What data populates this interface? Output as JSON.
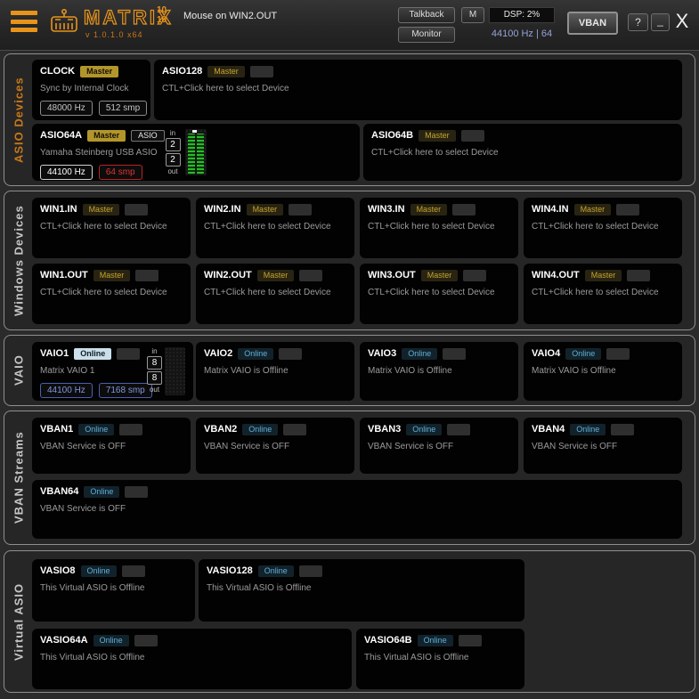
{
  "colors": {
    "accent_orange": "#e8941a",
    "master_gold": "#b3962a",
    "online_blue": "#5fb0d8",
    "alert_red": "#e23333",
    "vaio_blue": "#8096e0",
    "meter_green": "#27bd27"
  },
  "header": {
    "app_name": "MATRIX",
    "channels_top": "10",
    "channels_bottom": "10",
    "version": "v 1.0.1.0 x64",
    "status": "Mouse on WIN2.OUT",
    "talkback_label": "Talkback",
    "monitor_label": "Monitor",
    "mute_label": "M",
    "dsp_load": "DSP: 2%",
    "samplerate_info": "44100 Hz | 64",
    "vban_label": "VBAN",
    "help_label": "?",
    "minimize_label": "_",
    "close_label": "X"
  },
  "sections": {
    "asio": {
      "label": "ASIO Devices",
      "cells": {
        "clock": {
          "title": "CLOCK",
          "badge": "Master",
          "desc": "Sync by Internal Clock",
          "rate": "48000 Hz",
          "buffer": "512 smp"
        },
        "asio128": {
          "title": "ASIO128",
          "badge": "Master",
          "desc": "CTL+Click here to select Device"
        },
        "asio64a": {
          "title": "ASIO64A",
          "badge": "Master",
          "badge2": "ASIO",
          "desc": "Yamaha Steinberg USB ASIO",
          "rate": "44100 Hz",
          "buffer": "64 smp",
          "io": {
            "in_label": "in",
            "in_count": "2",
            "out_count": "2",
            "out_label": "out"
          }
        },
        "asio64b": {
          "title": "ASIO64B",
          "badge": "Master",
          "desc": "CTL+Click here to select Device"
        }
      }
    },
    "windows": {
      "label": "Windows Devices",
      "cells": {
        "win1in": {
          "title": "WIN1.IN",
          "badge": "Master",
          "desc": "CTL+Click here to select Device"
        },
        "win2in": {
          "title": "WIN2.IN",
          "badge": "Master",
          "desc": "CTL+Click here to select Device"
        },
        "win3in": {
          "title": "WIN3.IN",
          "badge": "Master",
          "desc": "CTL+Click here to select Device"
        },
        "win4in": {
          "title": "WIN4.IN",
          "badge": "Master",
          "desc": "CTL+Click here to select Device"
        },
        "win1out": {
          "title": "WIN1.OUT",
          "badge": "Master",
          "desc": "CTL+Click here to select Device"
        },
        "win2out": {
          "title": "WIN2.OUT",
          "badge": "Master",
          "desc": "CTL+Click here to select Device"
        },
        "win3out": {
          "title": "WIN3.OUT",
          "badge": "Master",
          "desc": "CTL+Click here to select Device"
        },
        "win4out": {
          "title": "WIN4.OUT",
          "badge": "Master",
          "desc": "CTL+Click here to select Device"
        }
      }
    },
    "vaio": {
      "label": "VAIO",
      "cells": {
        "vaio1": {
          "title": "VAIO1",
          "badge": "Online",
          "desc": "Matrix VAIO 1",
          "rate": "44100 Hz",
          "buffer": "7168 smp",
          "io": {
            "in_label": "in",
            "in_count": "8",
            "out_count": "8",
            "out_label": "out"
          }
        },
        "vaio2": {
          "title": "VAIO2",
          "badge": "Online",
          "desc": "Matrix VAIO is Offline"
        },
        "vaio3": {
          "title": "VAIO3",
          "badge": "Online",
          "desc": "Matrix VAIO is Offline"
        },
        "vaio4": {
          "title": "VAIO4",
          "badge": "Online",
          "desc": "Matrix VAIO is Offline"
        }
      }
    },
    "vban": {
      "label": "VBAN Streams",
      "cells": {
        "vban1": {
          "title": "VBAN1",
          "badge": "Online",
          "desc": "VBAN Service is OFF"
        },
        "vban2": {
          "title": "VBAN2",
          "badge": "Online",
          "desc": "VBAN Service is OFF"
        },
        "vban3": {
          "title": "VBAN3",
          "badge": "Online",
          "desc": "VBAN Service is OFF"
        },
        "vban4": {
          "title": "VBAN4",
          "badge": "Online",
          "desc": "VBAN Service is OFF"
        },
        "vban64": {
          "title": "VBAN64",
          "badge": "Online",
          "desc": "VBAN Service is OFF"
        }
      }
    },
    "vasio": {
      "label": "Virtual ASIO",
      "cells": {
        "vasio8": {
          "title": "VASIO8",
          "badge": "Online",
          "desc": "This Virtual ASIO is Offline"
        },
        "vasio128": {
          "title": "VASIO128",
          "badge": "Online",
          "desc": "This Virtual ASIO is Offline"
        },
        "vasio64a": {
          "title": "VASIO64A",
          "badge": "Online",
          "desc": "This Virtual ASIO is Offline"
        },
        "vasio64b": {
          "title": "VASIO64B",
          "badge": "Online",
          "desc": "This Virtual ASIO is Offline"
        }
      }
    }
  }
}
